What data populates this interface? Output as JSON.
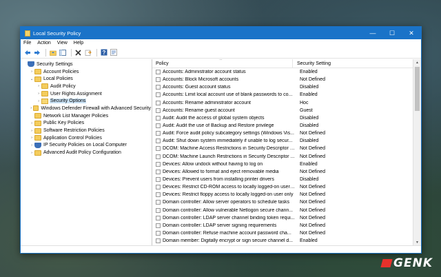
{
  "window": {
    "title": "Local Security Policy",
    "controls": {
      "minimize": "—",
      "maximize": "☐",
      "close": "✕"
    }
  },
  "menu": [
    "File",
    "Action",
    "View",
    "Help"
  ],
  "toolbar": {
    "icons": [
      "back-arrow-icon",
      "forward-arrow-icon",
      "folder-up-icon",
      "show-tree-icon",
      "delete-icon",
      "export-icon",
      "help-icon",
      "properties-icon"
    ]
  },
  "tree": [
    {
      "label": "Security Settings",
      "indent": 0,
      "caret": "",
      "icon": "shield",
      "selected": false
    },
    {
      "label": "Account Policies",
      "indent": 1,
      "caret": "›",
      "icon": "folder",
      "selected": false
    },
    {
      "label": "Local Policies",
      "indent": 1,
      "caret": "⌄",
      "icon": "folder",
      "selected": false
    },
    {
      "label": "Audit Policy",
      "indent": 2,
      "caret": "›",
      "icon": "folder",
      "selected": false
    },
    {
      "label": "User Rights Assignment",
      "indent": 2,
      "caret": "›",
      "icon": "folder",
      "selected": false
    },
    {
      "label": "Security Options",
      "indent": 2,
      "caret": "›",
      "icon": "openfolder",
      "selected": true
    },
    {
      "label": "Windows Defender Firewall with Advanced Security",
      "indent": 1,
      "caret": "›",
      "icon": "folder",
      "selected": false
    },
    {
      "label": "Network List Manager Policies",
      "indent": 1,
      "caret": "",
      "icon": "folder",
      "selected": false
    },
    {
      "label": "Public Key Policies",
      "indent": 1,
      "caret": "›",
      "icon": "folder",
      "selected": false
    },
    {
      "label": "Software Restriction Policies",
      "indent": 1,
      "caret": "›",
      "icon": "folder",
      "selected": false
    },
    {
      "label": "Application Control Policies",
      "indent": 1,
      "caret": "›",
      "icon": "folder",
      "selected": false
    },
    {
      "label": "IP Security Policies on Local Computer",
      "indent": 1,
      "caret": "›",
      "icon": "shield",
      "selected": false
    },
    {
      "label": "Advanced Audit Policy Configuration",
      "indent": 1,
      "caret": "›",
      "icon": "folder",
      "selected": false
    }
  ],
  "list": {
    "columns": {
      "policy": "Policy",
      "setting": "Security Setting"
    },
    "rows": [
      {
        "policy": "Accounts: Administrator account status",
        "setting": "Enabled"
      },
      {
        "policy": "Accounts: Block Microsoft accounts",
        "setting": "Not Defined"
      },
      {
        "policy": "Accounts: Guest account status",
        "setting": "Disabled"
      },
      {
        "policy": "Accounts: Limit local account use of blank passwords to co...",
        "setting": "Enabled"
      },
      {
        "policy": "Accounts: Rename administrator account",
        "setting": "Hoc"
      },
      {
        "policy": "Accounts: Rename guest account",
        "setting": "Guest"
      },
      {
        "policy": "Audit: Audit the access of global system objects",
        "setting": "Disabled"
      },
      {
        "policy": "Audit: Audit the use of Backup and Restore privilege",
        "setting": "Disabled"
      },
      {
        "policy": "Audit: Force audit policy subcategory settings (Windows Vis...",
        "setting": "Not Defined"
      },
      {
        "policy": "Audit: Shut down system immediately if unable to log secur...",
        "setting": "Disabled"
      },
      {
        "policy": "DCOM: Machine Access Restrictions in Security Descriptor D...",
        "setting": "Not Defined"
      },
      {
        "policy": "DCOM: Machine Launch Restrictions in Security Descriptor ...",
        "setting": "Not Defined"
      },
      {
        "policy": "Devices: Allow undock without having to log on",
        "setting": "Enabled"
      },
      {
        "policy": "Devices: Allowed to format and eject removable media",
        "setting": "Not Defined"
      },
      {
        "policy": "Devices: Prevent users from installing printer drivers",
        "setting": "Disabled"
      },
      {
        "policy": "Devices: Restrict CD-ROM access to locally logged-on user ...",
        "setting": "Not Defined"
      },
      {
        "policy": "Devices: Restrict floppy access to locally logged-on user only",
        "setting": "Not Defined"
      },
      {
        "policy": "Domain controller: Allow server operators to schedule tasks",
        "setting": "Not Defined"
      },
      {
        "policy": "Domain controller: Allow vulnerable Netlogon secure chann...",
        "setting": "Not Defined"
      },
      {
        "policy": "Domain controller: LDAP server channel binding token requi...",
        "setting": "Not Defined"
      },
      {
        "policy": "Domain controller: LDAP server signing requirements",
        "setting": "Not Defined"
      },
      {
        "policy": "Domain controller: Refuse machine account password cha...",
        "setting": "Not Defined"
      },
      {
        "policy": "Domain member: Digitally encrypt or sign secure channel d...",
        "setting": "Enabled"
      }
    ]
  },
  "watermark": {
    "text": "GENK"
  }
}
